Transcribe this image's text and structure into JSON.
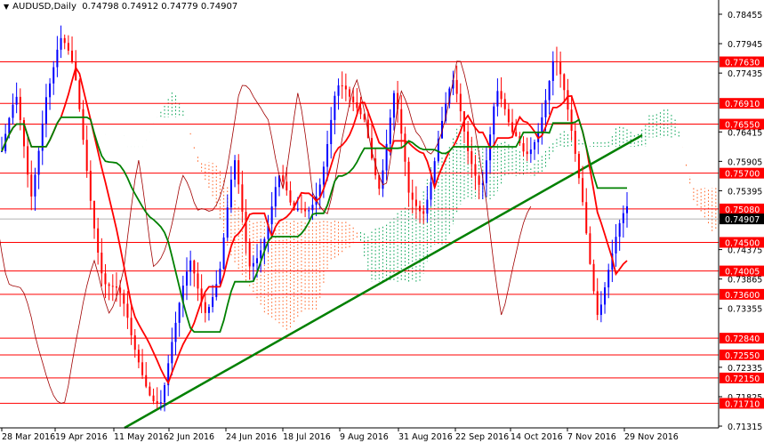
{
  "header": {
    "symbol": "AUDUSD,Daily",
    "ohlc": "0.74798 0.74912 0.74779 0.74907"
  },
  "price_axis": {
    "ticks": [
      "0.78455",
      "0.77945",
      "0.77435",
      "0.76415",
      "0.75905",
      "0.75395",
      "0.74375",
      "0.73865",
      "0.73355",
      "0.72335",
      "0.71825",
      "0.71315"
    ],
    "current_price": "0.74907"
  },
  "levels": [
    "0.77630",
    "0.76910",
    "0.76550",
    "0.75700",
    "0.75080",
    "0.74500",
    "0.74005",
    "0.73600",
    "0.72840",
    "0.72550",
    "0.72150",
    "0.71710"
  ],
  "date_axis": [
    "28 Mar 2016",
    "19 Apr 2016",
    "11 May 2016",
    "2 Jun 2016",
    "24 Jun 2016",
    "18 Jul 2016",
    "9 Aug 2016",
    "31 Aug 2016",
    "22 Sep 2016",
    "14 Oct 2016",
    "7 Nov 2016",
    "29 Nov 2016"
  ],
  "colors": {
    "bull": "#0000ff",
    "bear": "#ff0000",
    "level": "#ff0000",
    "kijun": "#008000",
    "tenkan": "#ff0000",
    "trend": "#008000",
    "cloud_up": "#00a050",
    "cloud_down": "#ff6020"
  },
  "chart_data": {
    "type": "candlestick",
    "closes": [
      0.7608,
      0.767,
      0.7531,
      0.7731,
      0.7793,
      0.7716,
      0.7562,
      0.7408,
      0.7346,
      0.7253,
      0.7223,
      0.7192,
      0.7284,
      0.7408,
      0.7361,
      0.7408,
      0.7562,
      0.7408,
      0.7485,
      0.7562,
      0.747,
      0.7516,
      0.7593,
      0.7701,
      0.767,
      0.7685,
      0.7562,
      0.7685,
      0.7516,
      0.7531,
      0.7639,
      0.7701,
      0.7608,
      0.7577,
      0.7716,
      0.7608,
      0.7608,
      0.7685,
      0.7762,
      0.7639,
      0.7531,
      0.7346,
      0.7408,
      0.749
    ]
  }
}
